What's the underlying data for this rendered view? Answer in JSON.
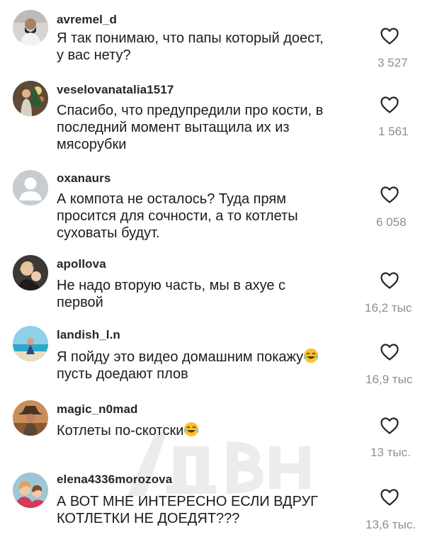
{
  "comments": [
    {
      "username": "avremel_d",
      "lines": [
        "Я так понимаю, что папы который доест,",
        "у вас нету?"
      ],
      "likes": "3 527"
    },
    {
      "username": "veselovanatalia1517",
      "lines": [
        "Спасибо, что предупредили про кости, в",
        "последний момент вытащила их из",
        "мясорубки"
      ],
      "likes": "1 561"
    },
    {
      "username": "oxanaurs",
      "lines": [
        "А компота не осталось? Туда прям",
        "просится для сочности, а то котлеты",
        "суховаты будут."
      ],
      "likes": "6 058"
    },
    {
      "username": "apollova",
      "lines": [
        "Не надо вторую часть, мы в ахуе с",
        "первой"
      ],
      "likes": "16,2 тыс"
    },
    {
      "username": "landish_l.n",
      "lines": [
        "Я пойду это видео домашним покажу",
        "пусть доедают плов"
      ],
      "likes": "16,9 тыс"
    },
    {
      "username": "magic_n0mad",
      "lines": [
        "Котлеты по-скотски"
      ],
      "likes": "13 тыс."
    },
    {
      "username": "elena4336morozova",
      "lines": [
        "А ВОТ МНЕ ИНТЕРЕСНО ЕСЛИ ВДРУГ",
        "КОТЛЕТКИ НЕ ДОЕДЯТ???"
      ],
      "likes": "13,6 тыс."
    }
  ],
  "icons": {
    "heart": "heart-outline-icon",
    "emoji": "face-with-tears-of-joy-emoji"
  },
  "colors": {
    "text": "#1c1c1c",
    "username": "#262626",
    "count": "#8e8e8e"
  }
}
